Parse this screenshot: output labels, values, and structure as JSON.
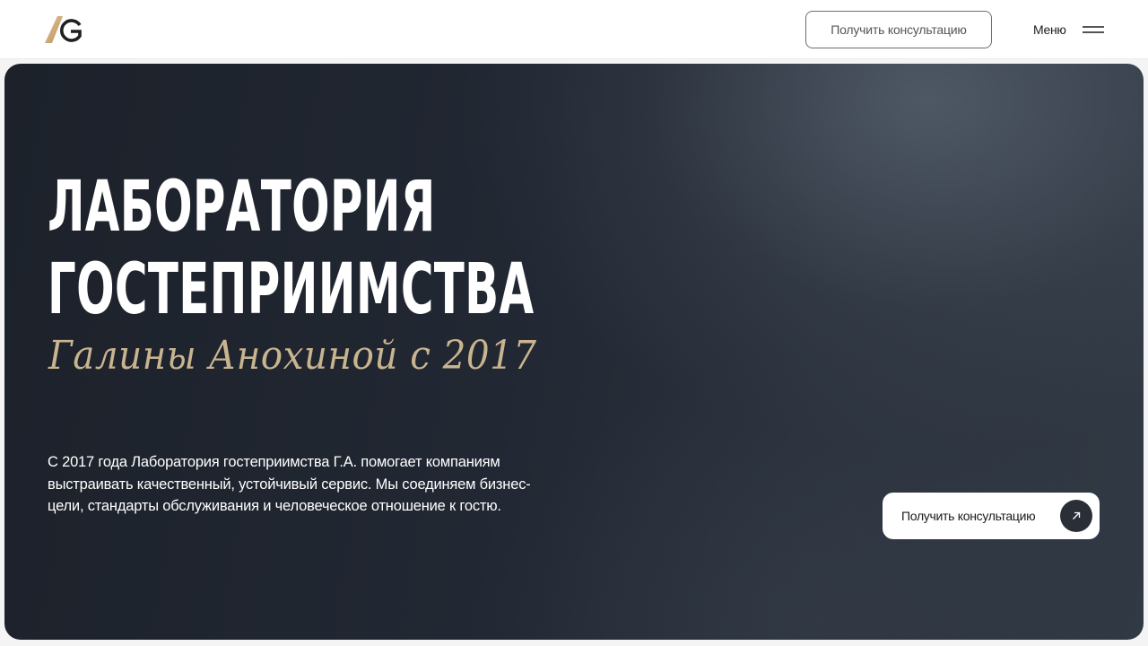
{
  "header": {
    "logo_icon": "ag-monogram-icon",
    "consult_button_label": "Получить консультацию",
    "menu_label": "Меню",
    "menu_icon": "hamburger-menu-icon"
  },
  "hero": {
    "title_line1": "ЛАБОРАТОРИЯ",
    "title_line2": "ГОСТЕПРИИМСТВА",
    "subtitle": "Галины Анохиной с 2017",
    "description": "С 2017 года Лаборатория гостеприимства Г.А. помогает компаниям выстраивать качественный, устойчивый сервис. Мы соединяем бизнес-цели, стандарты обслуживания и человеческое отношение к гостю.",
    "cta_label": "Получить консультацию",
    "cta_icon": "arrow-up-right-icon"
  },
  "colors": {
    "accent_gold": "#c8b48f",
    "hero_dark": "#1f242d",
    "button_dark": "#2a2f37"
  }
}
